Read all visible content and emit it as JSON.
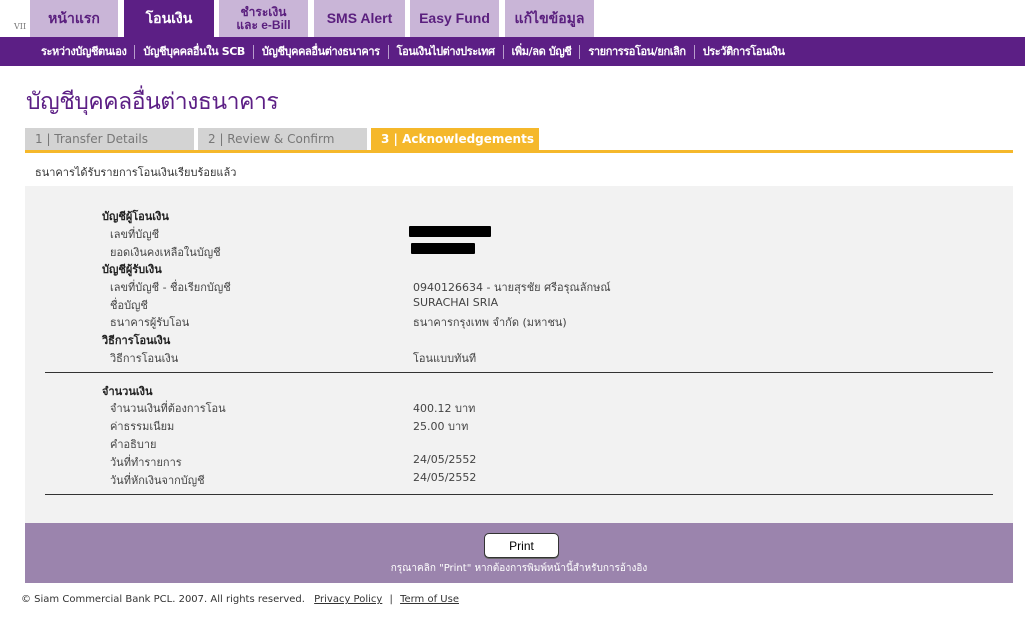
{
  "top_tabs": [
    {
      "label": "หน้าแรก"
    },
    {
      "label": "โอนเงิน"
    },
    {
      "label_line1": "ชำระเงิน",
      "label_line2": "และ e-Bill"
    },
    {
      "label": "SMS Alert"
    },
    {
      "label": "Easy Fund"
    },
    {
      "label": "แก้ไขข้อมูล"
    }
  ],
  "version_mark": "VII",
  "subnav": [
    "ระหว่างบัญชีตนเอง",
    "บัญชีบุคคลอื่นใน SCB",
    "บัญชีบุคคลอื่นต่างธนาคาร",
    "โอนเงินไปต่างประเทศ",
    "เพิ่ม/ลด บัญชี",
    "รายการรอโอน/ยกเลิก",
    "ประวัติการโอนเงิน"
  ],
  "page_title": "บัญชีบุคคลอื่นต่างธนาคาร",
  "steps": [
    {
      "label": "1 | Transfer Details"
    },
    {
      "label": "2 | Review & Confirm"
    },
    {
      "label": "3 | Acknowledgements"
    }
  ],
  "notice": "ธนาคารได้รับรายการโอนเงินเรียบร้อยแล้ว",
  "details": {
    "from_header": "บัญชีผู้โอนเงิน",
    "from_account_label": "เลขที่บัญชี",
    "from_balance_label": "ยอดเงินคงเหลือในบัญชี",
    "to_header": "บัญชีผู้รับเงิน",
    "to_account_label": "เลขที่บัญชี - ชื่อเรียกบัญชี",
    "to_account_value": "0940126634 - นายสุรชัย ศรีอรุณลักษณ์",
    "to_name_label": "ชื่อบัญชี",
    "to_name_value": "SURACHAI SRIA",
    "to_bank_label": "ธนาคารผู้รับโอน",
    "to_bank_value": "ธนาคารกรุงเทพ จำกัด (มหาชน)",
    "method_header": "วิธีการโอนเงิน",
    "method_label": "วิธีการโอนเงิน",
    "method_value": "โอนแบบทันที",
    "amount_header": "จำนวนเงิน",
    "amount_label": "จำนวนเงินที่ต้องการโอน",
    "amount_value": "400.12 บาท",
    "fee_label": "ค่าธรรมเนียม",
    "fee_value": "25.00  บาท",
    "description_label": "คำอธิบาย",
    "txn_date_label": "วันที่ทำรายการ",
    "txn_date_value": "24/05/2552",
    "debit_date_label": "วันที่หักเงินจากบัญชี",
    "debit_date_value": "24/05/2552"
  },
  "print_button": "Print",
  "print_hint": "กรุณาคลิก \"Print\" หากต้องการพิมพ์หน้านี้สำหรับการอ้างอิง",
  "copyright": "© Siam Commercial Bank PCL. 2007. All rights reserved.",
  "footer_links": [
    "Privacy Policy",
    "Term of Use"
  ],
  "colors": {
    "brand_purple": "#5c1f85",
    "tab_inactive": "#c9b5d7",
    "step_active": "#f5b82b",
    "action_bar": "#9b84ad"
  }
}
